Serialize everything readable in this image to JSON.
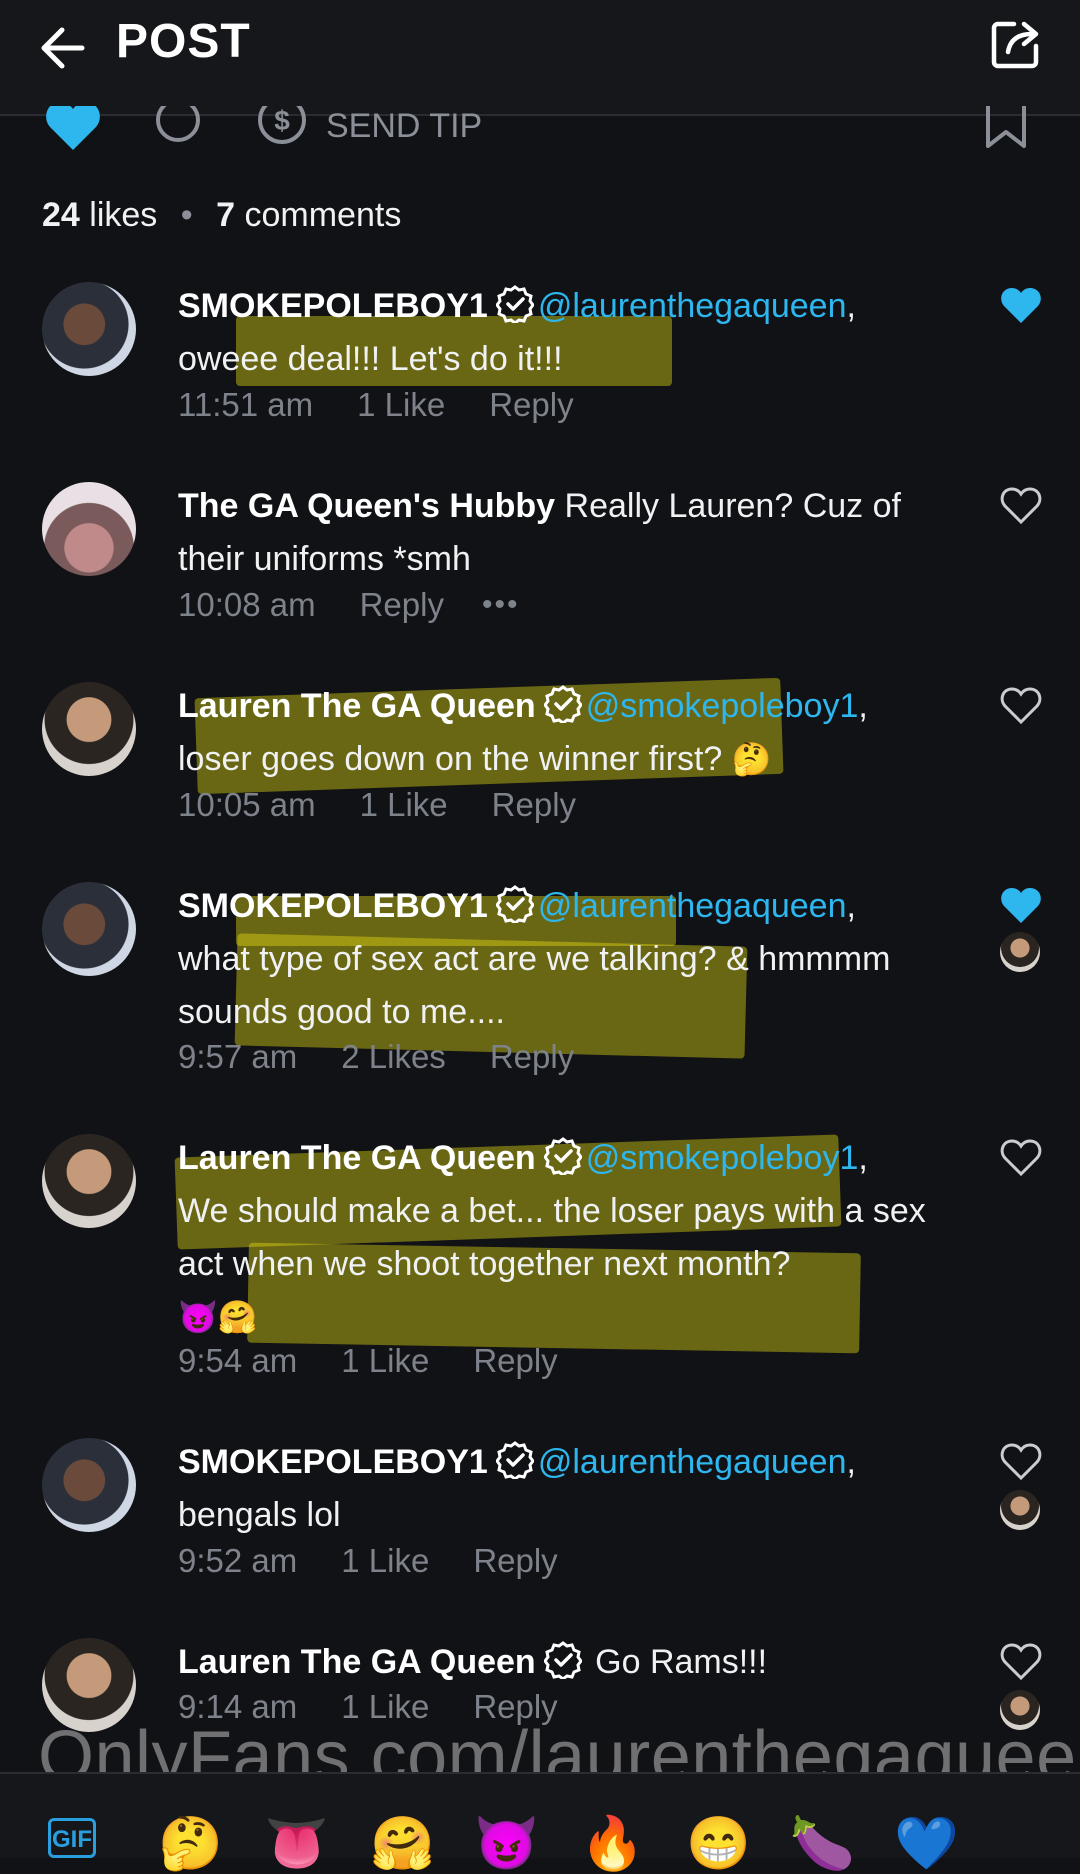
{
  "header": {
    "title": "POST"
  },
  "actions": {
    "send_tip": "SEND TIP"
  },
  "stats": {
    "likes_count": "24",
    "likes_label": "likes",
    "comments_count": "7",
    "comments_label": "comments"
  },
  "comments": [
    {
      "user": "SMOKEPOLEBOY1",
      "mention": "@laurenthegaqueen",
      "after_mention": ",",
      "text": "oweee deal!!! Let's do it!!!",
      "time": "11:51 am",
      "likes": "1 Like",
      "reply": "Reply",
      "liked": true
    },
    {
      "user": "The GA Queen's Hubby",
      "text": "Really Lauren? Cuz of their uniforms *smh",
      "time": "10:08 am",
      "reply": "Reply",
      "more": "•••",
      "liked": false
    },
    {
      "user": "Lauren The GA Queen",
      "mention": "@smokepoleboy1",
      "after_mention": ",",
      "text": "loser goes down on the winner first?",
      "emoji": "🤔",
      "time": "10:05 am",
      "likes": "1 Like",
      "reply": "Reply",
      "liked": false
    },
    {
      "user": "SMOKEPOLEBOY1",
      "mention": "@laurenthegaqueen",
      "after_mention": ",",
      "text": "what type of sex act are we talking? & hmmmm sounds good to me....",
      "time": "9:57 am",
      "likes": "2 Likes",
      "reply": "Reply",
      "liked": true
    },
    {
      "user": "Lauren The GA Queen",
      "mention": "@smokepoleboy1",
      "after_mention": ",",
      "text": "We should make a bet... the loser pays with a sex act when we shoot together next month?",
      "emoji": "😈🤗",
      "time": "9:54 am",
      "likes": "1 Like",
      "reply": "Reply",
      "liked": false
    },
    {
      "user": "SMOKEPOLEBOY1",
      "mention": "@laurenthegaqueen",
      "after_mention": ",",
      "text": "bengals lol",
      "time": "9:52 am",
      "likes": "1 Like",
      "reply": "Reply",
      "liked": false
    },
    {
      "user": "Lauren The GA Queen",
      "text": "Go Rams!!!",
      "time": "9:14 am",
      "likes": "1 Like",
      "reply": "Reply",
      "liked": false
    }
  ],
  "watermark": "OnlyFans.com/laurenthegaqueen",
  "emoji_bar": {
    "gif": "GIF",
    "emojis": [
      "🤔",
      "👅",
      "🤗",
      "😈",
      "🔥",
      "😁",
      "🍆",
      "💙"
    ]
  },
  "colors": {
    "accent": "#2eb6ee",
    "background": "#111215",
    "highlight": "#e6de12"
  }
}
